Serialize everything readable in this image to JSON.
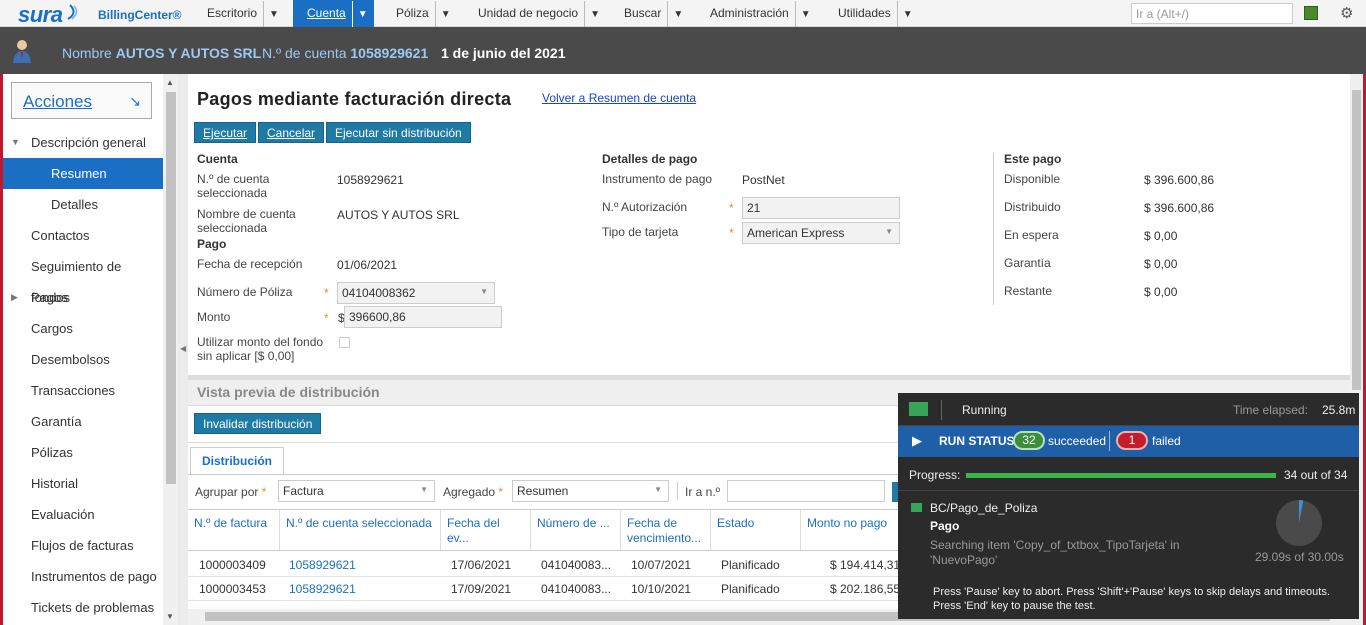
{
  "topbar": {
    "logo": "sura",
    "product": "BillingCenter®",
    "tabs": [
      {
        "label": "Escritorio"
      },
      {
        "label": "Cuenta"
      },
      {
        "label": "Póliza"
      },
      {
        "label": "Unidad de negocio"
      },
      {
        "label": "Buscar"
      },
      {
        "label": "Administración"
      },
      {
        "label": "Utilidades"
      }
    ],
    "goto_placeholder": "Ir a (Alt+/)"
  },
  "header": {
    "name_label": "Nombre",
    "name_value": "AUTOS Y AUTOS SRL",
    "account_label": "N.º de cuenta",
    "account_value": "1058929621",
    "date": "1 de junio del 2021"
  },
  "sidebar": {
    "actions": "Acciones",
    "items": [
      {
        "label": "Descripción general"
      },
      {
        "label": "Resumen"
      },
      {
        "label": "Detalles"
      },
      {
        "label": "Contactos"
      },
      {
        "label": "Seguimiento de fondos"
      },
      {
        "label": "Pagos"
      },
      {
        "label": "Cargos"
      },
      {
        "label": "Desembolsos"
      },
      {
        "label": "Transacciones"
      },
      {
        "label": "Garantía"
      },
      {
        "label": "Pólizas"
      },
      {
        "label": "Historial"
      },
      {
        "label": "Evaluación"
      },
      {
        "label": "Flujos de facturas"
      },
      {
        "label": "Instrumentos de pago"
      },
      {
        "label": "Tickets de problemas"
      }
    ]
  },
  "main": {
    "title": "Pagos mediante facturación directa",
    "back_link": "Volver a Resumen de cuenta",
    "buttons": {
      "execute": "Ejecutar",
      "cancel": "Cancelar",
      "execute_no_dist": "Ejecutar sin distribución"
    },
    "cuenta": {
      "title": "Cuenta",
      "acct_label": "N.º de cuenta seleccionada",
      "acct_value": "1058929621",
      "name_label": "Nombre de cuenta seleccionada",
      "name_value": "AUTOS Y AUTOS SRL"
    },
    "pago": {
      "title": "Pago",
      "date_label": "Fecha de recepción",
      "date_value": "01/06/2021",
      "policy_label": "Número de Póliza",
      "policy_value": "04104008362",
      "amount_label": "Monto",
      "currency": "$",
      "amount_value": "396600,86",
      "fund_label": "Utilizar monto del fondo sin aplicar [$ 0,00]"
    },
    "detalles": {
      "title": "Detalles de pago",
      "instr_label": "Instrumento de pago",
      "instr_value": "PostNet",
      "auth_label": "N.º Autorización",
      "auth_value": "21",
      "card_label": "Tipo de tarjeta",
      "card_value": "American Express"
    },
    "este_pago": {
      "title": "Este pago",
      "rows": [
        {
          "label": "Disponible",
          "value": "$ 396.600,86"
        },
        {
          "label": "Distribuido",
          "value": "$ 396.600,86"
        },
        {
          "label": "En espera",
          "value": "$ 0,00"
        },
        {
          "label": "Garantía",
          "value": "$ 0,00"
        },
        {
          "label": "Restante",
          "value": "$ 0,00"
        }
      ]
    },
    "preview": {
      "title": "Vista previa de distribución",
      "invalidate": "Invalidar distribución",
      "tab": "Distribución",
      "group_label": "Agrupar por",
      "group_value": "Factura",
      "agg_label": "Agregado",
      "agg_value": "Resumen",
      "goto_label": "Ir a n.º"
    },
    "table": {
      "headers": [
        "N.º de factura",
        "N.º de cuenta seleccionada",
        "Fecha del ev...",
        "Número de ...",
        "Fecha de vencimiento...",
        "Estado",
        "Monto no pago"
      ],
      "rows": [
        [
          "1000003409",
          "1058929621",
          "17/06/2021",
          "041040083...",
          "10/07/2021",
          "Planificado",
          "$ 194.414,31"
        ],
        [
          "1000003453",
          "1058929621",
          "17/09/2021",
          "041040083...",
          "10/10/2021",
          "Planificado",
          "$ 202.186,55"
        ]
      ]
    }
  },
  "runner": {
    "status": "Running",
    "elapsed_label": "Time elapsed:",
    "elapsed_value": "25.8m",
    "run_status": "RUN STATUS",
    "succeeded_count": "32",
    "succeeded_label": "succeeded",
    "failed_count": "1",
    "failed_label": "failed",
    "progress_label": "Progress:",
    "progress_value": "34 out of 34",
    "progress_fraction": 1.0,
    "test_name": "BC/Pago_de_Poliza",
    "step": "Pago",
    "searching": "Searching item 'Copy_of_txtbox_TipoTarjeta' in 'NuevoPago'",
    "timer": "29.09s of 30.00s",
    "timer_fraction": 0.97,
    "tip": "Press 'Pause' key to abort. Press 'Shift'+'Pause' keys to skip delays and timeouts. Press 'End' key to pause the test."
  },
  "colors": {
    "brand": "#1a6fc4",
    "header_bg": "#4a4a4a",
    "button": "#1f7aa5",
    "success": "#3a8e3c",
    "fail": "#c41e2d"
  }
}
